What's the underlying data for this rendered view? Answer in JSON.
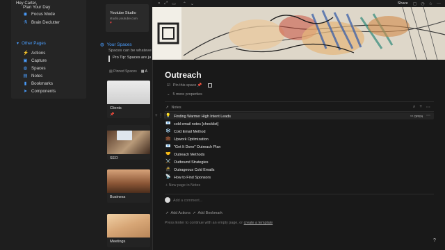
{
  "left": {
    "greeting": "Hey Carter,",
    "nav_top": [
      {
        "label": "Plan Your Day",
        "icon": "calendar-icon"
      },
      {
        "label": "Focus Mode",
        "icon": "eye-icon"
      },
      {
        "label": "Brain Declutter",
        "icon": "flask-icon"
      }
    ],
    "other_pages_label": "Other Pages",
    "other_pages": [
      {
        "label": "Actions",
        "icon": "lightning-icon"
      },
      {
        "label": "Capture",
        "icon": "inbox-icon"
      },
      {
        "label": "Spaces",
        "icon": "planet-icon"
      },
      {
        "label": "Notes",
        "icon": "note-icon"
      },
      {
        "label": "Bookmarks",
        "icon": "bookmark-icon"
      },
      {
        "label": "Components",
        "icon": "arrow-icon"
      }
    ],
    "youtube": {
      "title": "Youtube Studio",
      "url": "studio.youtube.com"
    },
    "spaces": {
      "title": "Your Spaces",
      "subtitle": "Spaces can be whatever",
      "tip": "Pro Tip: Spaces are ju",
      "tab_pinned": "Pinned Spaces",
      "tab_all": "A"
    },
    "space_cards": [
      {
        "label": "Clients",
        "pinned": "📌"
      },
      {
        "label": "SEO"
      },
      {
        "label": "Business"
      },
      {
        "label": "Meetings"
      }
    ]
  },
  "topbar": {
    "share": "Share"
  },
  "page": {
    "title": "Outreach",
    "pin_label": "Pin this space 📌",
    "more_props": "5 more properties",
    "db_label": "Notes",
    "open_label": "OPEN",
    "rows": [
      {
        "emoji": "💡",
        "label": "Finding Warmer High Intent Leads"
      },
      {
        "emoji": "📧",
        "label": "cold email notes [checklist]"
      },
      {
        "emoji": "❄️",
        "label": "Cold Email Method"
      },
      {
        "emoji": "💼",
        "label": "Upwork Optimization"
      },
      {
        "emoji": "📧",
        "label": "\"Get It Done\" Outreach Plan"
      },
      {
        "emoji": "🤝",
        "label": "Outreach Methods"
      },
      {
        "emoji": "⚔️",
        "label": "Outbound Strategies"
      },
      {
        "emoji": "🥷",
        "label": "Outrageous Cold Emails"
      },
      {
        "emoji": "📡",
        "label": "How to Find Sponsors"
      }
    ],
    "new_page": "+ New page in Notes",
    "comment_placeholder": "Add a comment...",
    "add_actions": "Add Actions",
    "add_bookmark": "Add Bookmark",
    "footer_hint": "Press Enter to continue with an empty page, or",
    "footer_link": "create a template",
    "help": "?"
  },
  "colors": {
    "accent": "#4a9eff",
    "background": "#191919"
  }
}
